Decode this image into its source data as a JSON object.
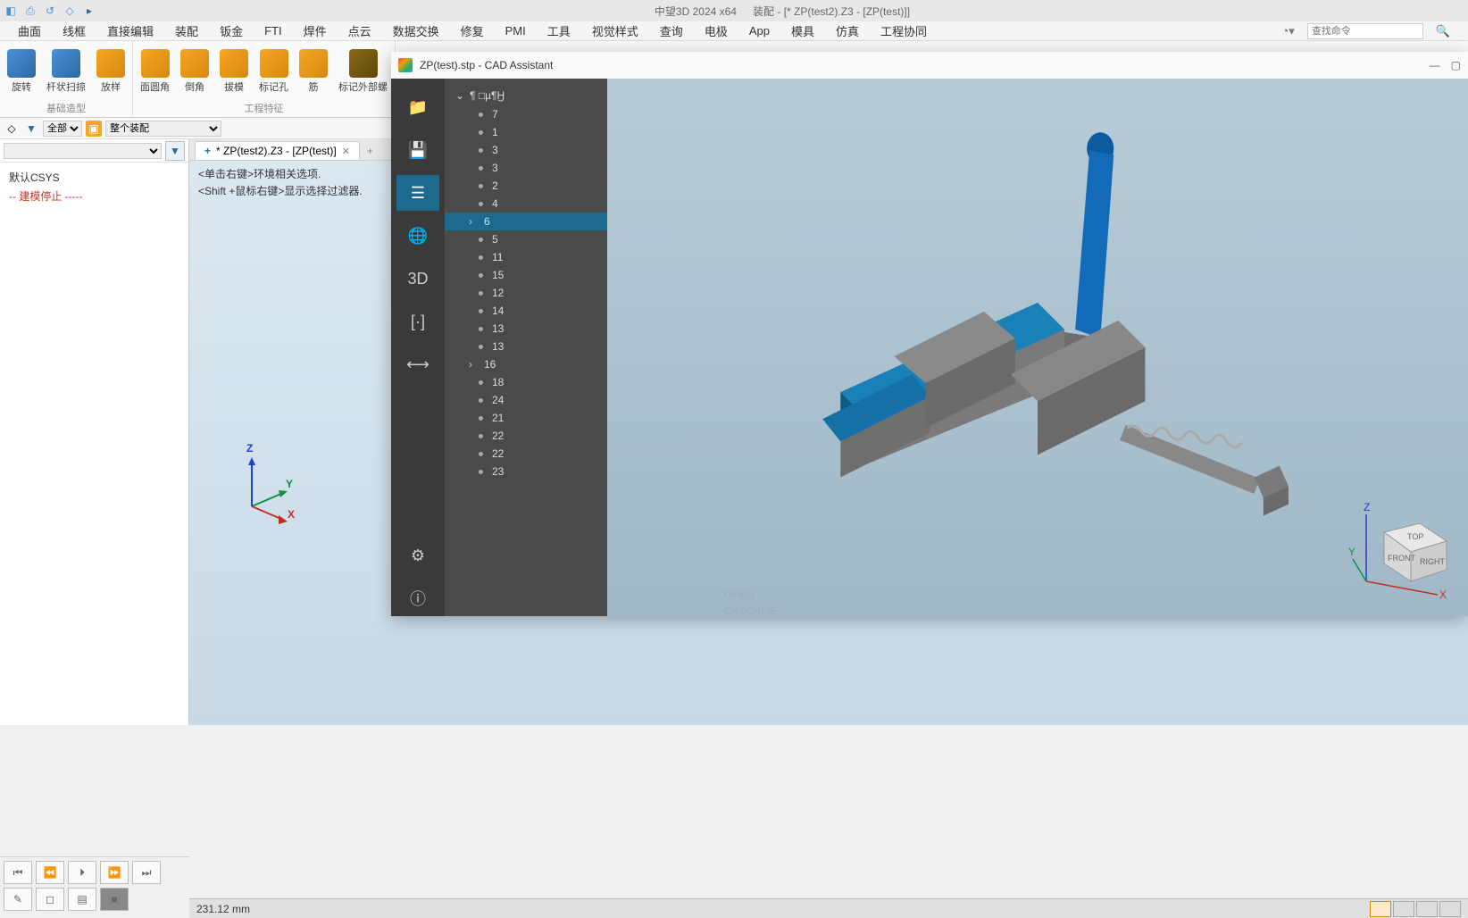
{
  "title": {
    "app": "中望3D 2024 x64",
    "doc": "装配 - [* ZP(test2).Z3 - [ZP(test)]]"
  },
  "menus": [
    "曲面",
    "线框",
    "直接编辑",
    "装配",
    "钣金",
    "FTI",
    "焊件",
    "点云",
    "数据交换",
    "修复",
    "PMI",
    "工具",
    "视觉样式",
    "查询",
    "电极",
    "App",
    "模具",
    "仿真",
    "工程协同"
  ],
  "search_placeholder": "查找命令",
  "ribbon": {
    "group1": {
      "name": "基础造型",
      "tools": [
        "旋转",
        "杆状扫掠",
        "放样"
      ]
    },
    "group2": {
      "name": "工程特征",
      "tools": [
        "面圆角",
        "倒角",
        "拔模",
        "标记孔",
        "筋",
        "标记外部螺"
      ]
    }
  },
  "smallbar": {
    "filter": "全部",
    "scope": "整个装配"
  },
  "doctab": {
    "label": "* ZP(test2).Z3 - [ZP(test)]"
  },
  "hints": {
    "l1": "<单击右键>环境相关选项.",
    "l2": "<Shift +鼠标右键>显示选择过滤器."
  },
  "tree": {
    "csys": "默认CSYS",
    "stop": "-- 建模停止 -----"
  },
  "statusbar": {
    "measure": "231.12 mm"
  },
  "cad": {
    "title": "ZP(test).stp - CAD Assistant",
    "root": "¶ □µ¶Ӈ",
    "items": [
      "7",
      "1",
      "3",
      "3",
      "2",
      "4",
      "6",
      "5",
      "11",
      "15",
      "12",
      "14",
      "13",
      "13",
      "16",
      "18",
      "24",
      "21",
      "22",
      "22",
      "23"
    ],
    "selected_index": 6,
    "expandable_indices": [
      6,
      14
    ]
  },
  "viewcube": {
    "top": "TOP",
    "front": "FRONT",
    "right": "RIGHT",
    "x": "X",
    "y": "Y",
    "z": "Z"
  },
  "axis": {
    "x": "X",
    "y": "Y",
    "z": "Z"
  }
}
